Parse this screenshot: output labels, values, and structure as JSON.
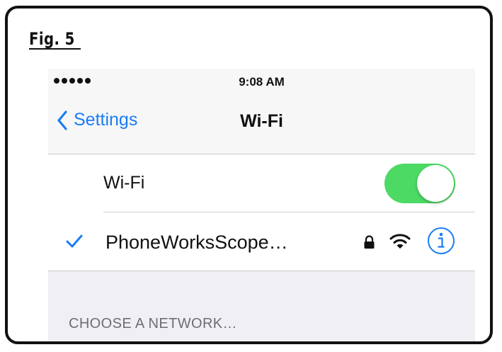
{
  "figure": {
    "label": "Fig. 5"
  },
  "status_bar": {
    "time": "9:08 AM",
    "signal_icon": "signal-dots-icon"
  },
  "nav": {
    "back_label": "Settings",
    "back_icon": "chevron-left-icon",
    "title": "Wi-Fi"
  },
  "wifi_toggle": {
    "label": "Wi-Fi",
    "on": true,
    "on_color": "#4cd964"
  },
  "connected_network": {
    "name": "PhoneWorksScope…",
    "selected_icon": "checkmark-icon",
    "icons": [
      "lock-icon",
      "wifi-icon",
      "info-icon"
    ],
    "accent_color": "#1a7cf5"
  },
  "section": {
    "header": "CHOOSE A NETWORK…"
  }
}
